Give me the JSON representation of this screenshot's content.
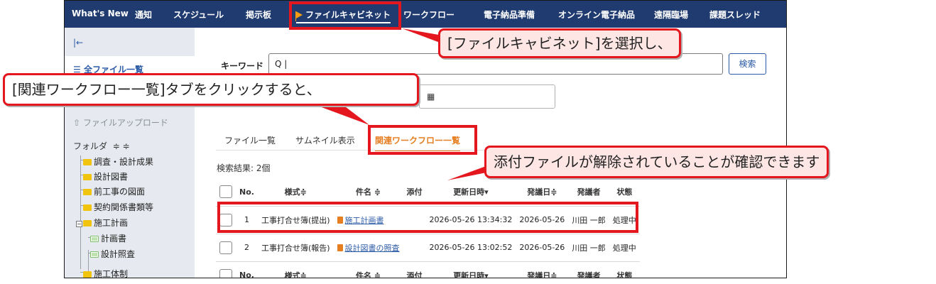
{
  "nav": {
    "items": [
      "What's New",
      "通知",
      "スケジュール",
      "掲示板",
      "ファイルキャビネット",
      "ワークフロー",
      "電子納品準備",
      "オンライン電子納品",
      "遠隔臨場",
      "課題スレッド"
    ],
    "active_index": 4
  },
  "sidebar": {
    "collapse_glyph": "|←",
    "all_files": "全ファイル一覧",
    "upload": "ファイルアップロード",
    "folder_header": "フォルダ",
    "sort_glyphs": "≑ ≑",
    "folders": [
      "調査・設計成果",
      "設計図書",
      "前工事の図面",
      "契約関係書類等",
      "施工計画",
      "計画書",
      "設計照査",
      "施工体制"
    ]
  },
  "search": {
    "keyword_label": "キーワード",
    "keyword_value": "Q |",
    "button": "検索",
    "date_glyph": "▦"
  },
  "tabs": [
    "ファイル一覧",
    "サムネイル表示",
    "関連ワークフロー一覧"
  ],
  "active_tab": 2,
  "result_count": "検索結果: 2個",
  "table": {
    "headers": [
      "No.",
      "様式≑",
      "件名 ≑",
      "添付",
      "更新日時▾",
      "発議日≑",
      "発議者",
      "状態"
    ],
    "rows": [
      [
        "1",
        "工事打合せ簿(提出)",
        "施工計画書",
        "",
        "2026-05-26 13:34:32",
        "2026-05-26",
        "川田 一郎",
        "処理中"
      ],
      [
        "2",
        "工事打合せ簿(報告)",
        "設計図書の照査",
        "",
        "2026-05-26 13:02:52",
        "2026-05-26",
        "川田 一郎",
        "処理中"
      ]
    ]
  },
  "callouts": {
    "cabinet": "[ファイルキャビネット]を選択し、",
    "workflow_tab": "[関連ワークフロー一覧]タブをクリックすると、",
    "attachment": "添付ファイルが解除されていることが確認できます"
  },
  "colors": {
    "nav_bg": "#1f3b6f",
    "accent_red": "#e4161e",
    "callout_fill": "#fde6e4",
    "tab_active": "#e67e22",
    "link": "#2b5aa6"
  }
}
